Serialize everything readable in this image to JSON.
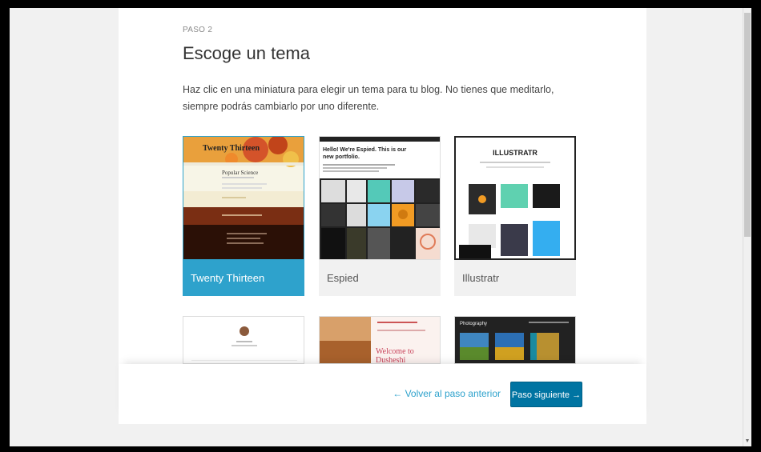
{
  "step_label": "PASO 2",
  "title": "Escoge un tema",
  "description": "Haz clic en una miniatura para elegir un tema para tu blog. No tienes que meditarlo, siempre podrás cambiarlo por uno diferente.",
  "themes": [
    {
      "name": "Twenty Thirteen",
      "selected": true,
      "preview_title": "Twenty Thirteen",
      "preview_heading": "Popular Science"
    },
    {
      "name": "Espied",
      "selected": false,
      "preview_heading": "Hello! We're Espied. This is our new portfolio."
    },
    {
      "name": "Illustratr",
      "selected": false,
      "preview_heading": "ILLUSTRATR"
    }
  ],
  "row2_themes": [
    {
      "preview_heading": ""
    },
    {
      "preview_heading": "Welcome to Dusheshi"
    },
    {
      "preview_heading": "Photography"
    }
  ],
  "footer": {
    "back_label": "← Volver al paso anterior",
    "next_label": "Paso siguiente →"
  },
  "colors": {
    "accent": "#2ea2cc",
    "primary_button": "#0074a2"
  }
}
